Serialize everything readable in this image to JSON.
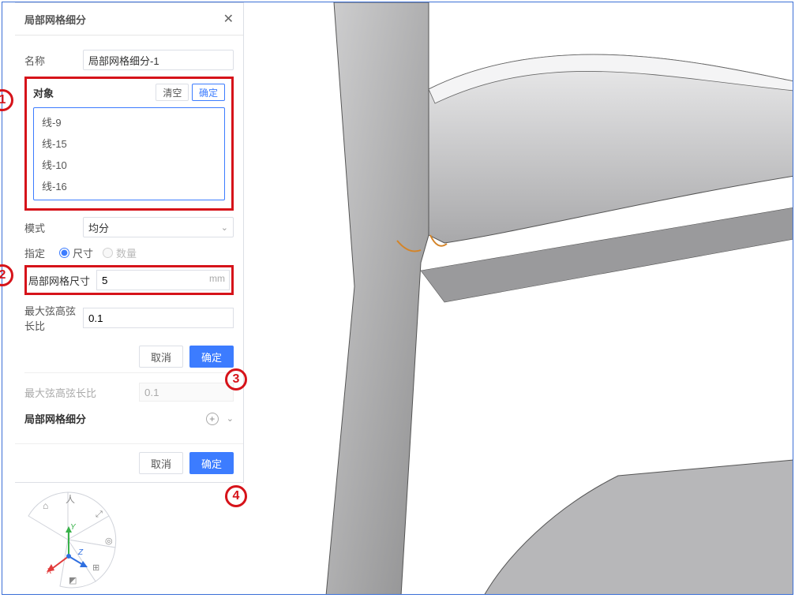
{
  "panel": {
    "title": "局部网格细分",
    "name_label": "名称",
    "name_value": "局部网格细分-1",
    "object": {
      "title": "对象",
      "clear_btn": "清空",
      "ok_btn": "确定",
      "items": [
        "线-9",
        "线-15",
        "线-10",
        "线-16"
      ]
    },
    "mode_label": "模式",
    "mode_value": "均分",
    "specify_label": "指定",
    "radio_size": "尺寸",
    "radio_count": "数量",
    "local_size_label": "局部网格尺寸",
    "local_size_value": "5",
    "local_size_unit": "mm",
    "chord_label": "最大弦高弦长比",
    "chord_value": "0.1",
    "cancel_btn": "取消",
    "ok_btn": "确定",
    "sub": {
      "ghost_label": "最大弦高弦长比",
      "ghost_value": "0.1",
      "section_title": "局部网格细分",
      "cancel_btn": "取消",
      "ok_btn": "确定"
    }
  },
  "annotations": {
    "a1": "1",
    "a2": "2",
    "a3": "3",
    "a4": "4"
  },
  "triad": {
    "x": "X",
    "y": "Y",
    "z": "Z"
  }
}
